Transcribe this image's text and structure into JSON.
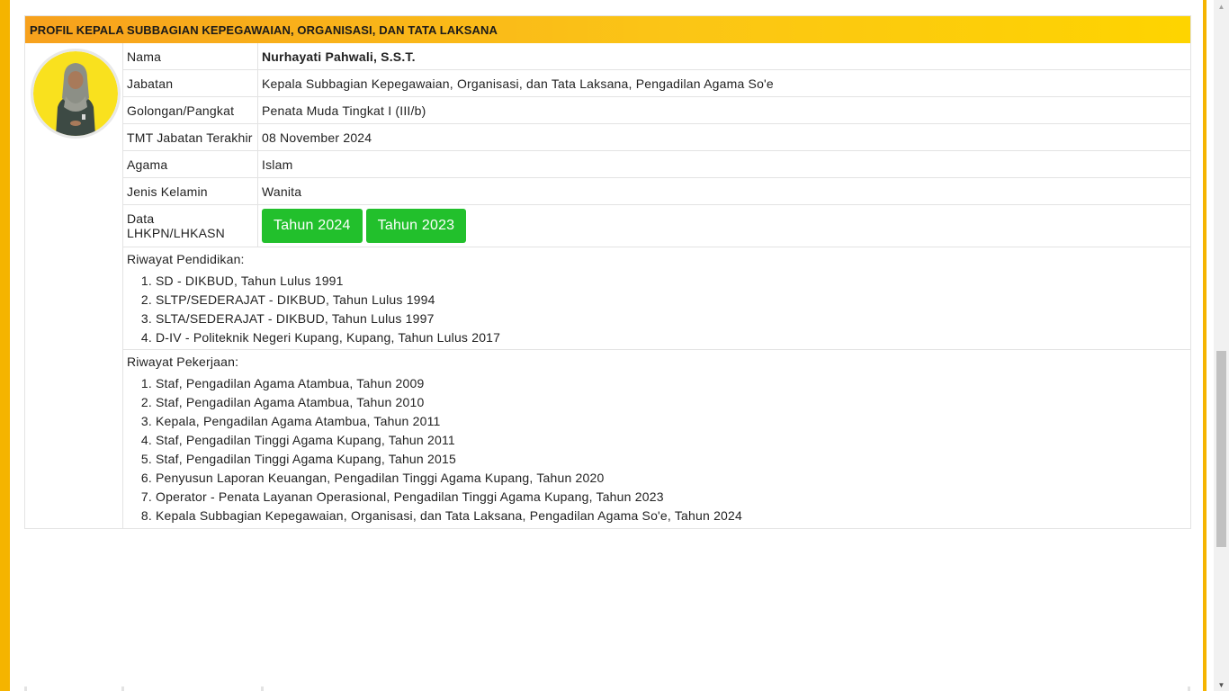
{
  "panel": {
    "title": "PROFIL KEPALA SUBBAGIAN KEPEGAWAIAN, ORGANISASI, DAN TATA LAKSANA"
  },
  "profile": {
    "fields": [
      {
        "label": "Nama",
        "value": "Nurhayati Pahwali, S.S.T."
      },
      {
        "label": "Jabatan",
        "value": "Kepala Subbagian Kepegawaian, Organisasi, dan Tata Laksana, Pengadilan Agama So'e"
      },
      {
        "label": "Golongan/Pangkat",
        "value": "Penata Muda Tingkat I (III/b)"
      },
      {
        "label": "TMT Jabatan Terakhir",
        "value": "08 November 2024"
      },
      {
        "label": "Agama",
        "value": "Islam"
      },
      {
        "label": "Jenis Kelamin",
        "value": "Wanita"
      }
    ],
    "lhkpn": {
      "label": "Data LHKPN/LHKASN",
      "buttons": [
        "Tahun 2024",
        "Tahun 2023"
      ]
    },
    "education": {
      "title": "Riwayat Pendidikan:",
      "items": [
        "SD - DIKBUD, Tahun Lulus 1991",
        "SLTP/SEDERAJAT - DIKBUD, Tahun Lulus 1994",
        "SLTA/SEDERAJAT - DIKBUD, Tahun Lulus 1997",
        "D-IV - Politeknik Negeri Kupang, Kupang, Tahun Lulus 2017"
      ]
    },
    "work": {
      "title": "Riwayat Pekerjaan:",
      "items": [
        "Staf, Pengadilan Agama Atambua, Tahun 2009",
        "Staf, Pengadilan Agama Atambua, Tahun 2010",
        "Kepala, Pengadilan Agama Atambua, Tahun 2011",
        "Staf, Pengadilan Tinggi Agama Kupang, Tahun 2011",
        "Staf, Pengadilan Tinggi Agama Kupang, Tahun 2015",
        "Penyusun Laporan Keuangan, Pengadilan Tinggi Agama Kupang, Tahun 2020",
        "Operator - Penata Layanan Operasional, Pengadilan Tinggi Agama Kupang, Tahun 2023",
        "Kepala Subbagian Kepegawaian, Organisasi, dan Tata Laksana, Pengadilan Agama So'e, Tahun 2024"
      ]
    }
  },
  "colors": {
    "header_gradient_start": "#f7a11d",
    "header_gradient_end": "#fed400",
    "button_green": "#22c02c",
    "avatar_background": "#f9e11e"
  },
  "icons": {
    "scroll_up": "scroll-up-arrow-icon",
    "scroll_down": "scroll-down-arrow-icon"
  }
}
